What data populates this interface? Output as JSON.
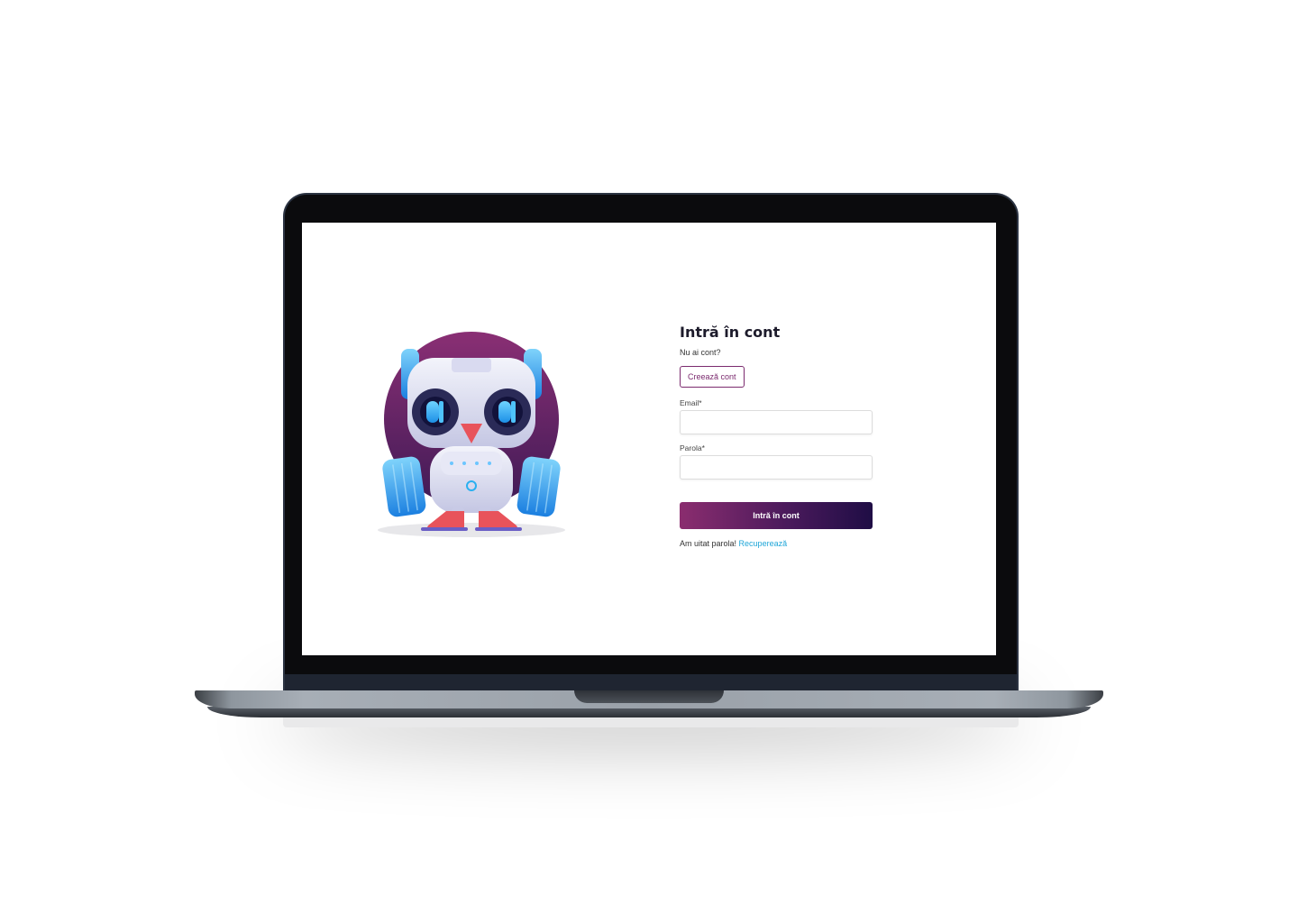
{
  "login": {
    "title": "Intră în cont",
    "no_account_text": "Nu ai cont?",
    "create_account_label": "Creează cont",
    "email_label": "Email*",
    "email_value": "",
    "password_label": "Parola*",
    "password_value": "",
    "submit_label": "Intră în cont",
    "forgot_text": "Am uitat parola!",
    "recover_link": "Recuperează"
  },
  "colors": {
    "brand_purple": "#7b2a6e",
    "button_gradient_start": "#8b2d6f",
    "button_gradient_end": "#1f0d45",
    "link_blue": "#1fa6d8",
    "mascot_eye_blue": "#2ab0f0",
    "mascot_beak": "#e8535b"
  },
  "illustration": {
    "icon": "robot-owl-mascot-icon"
  }
}
